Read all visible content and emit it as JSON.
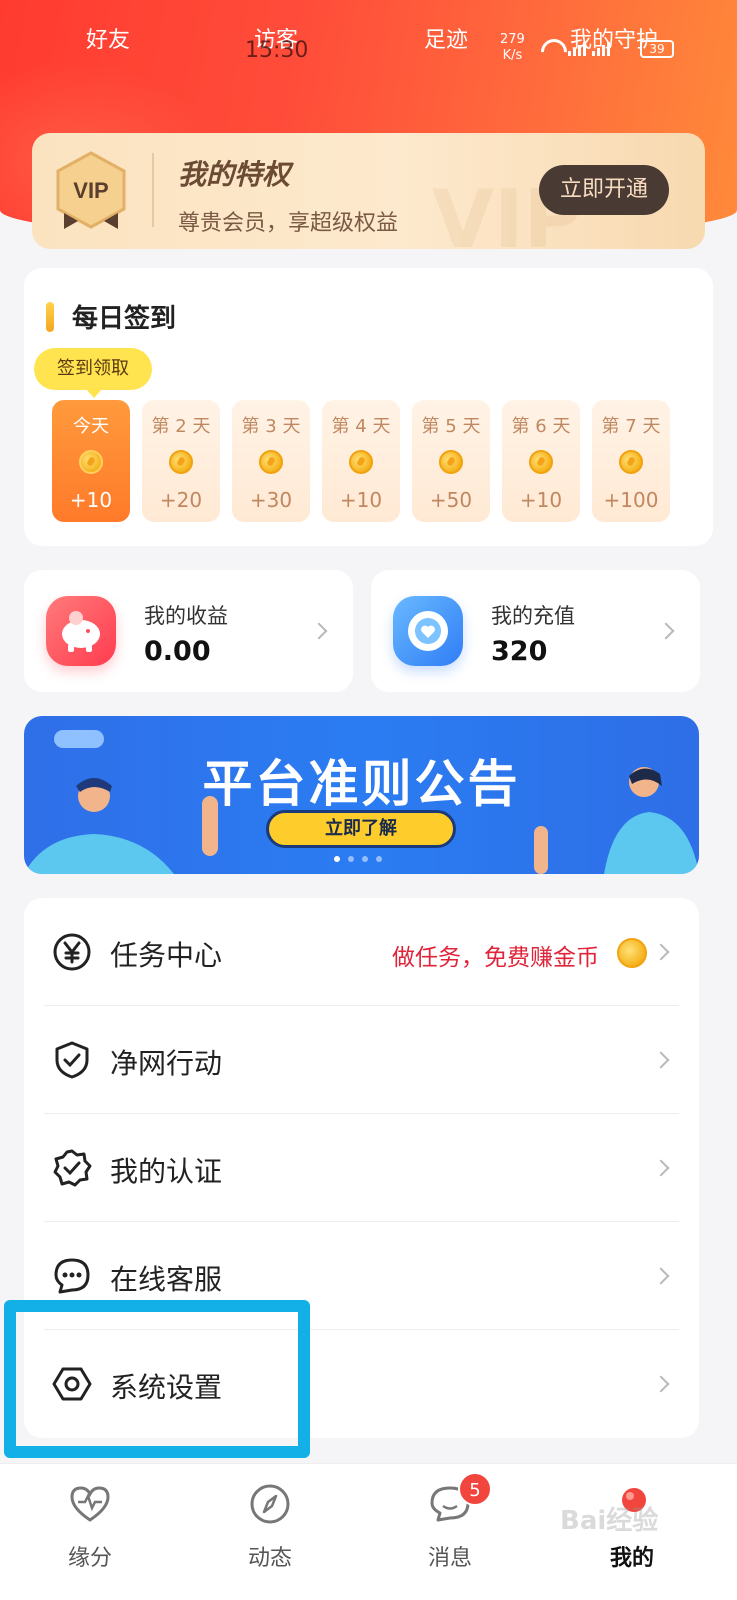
{
  "status_bar": {
    "time": "15:30",
    "speed": "279\nK/s",
    "battery": "39"
  },
  "top_nav": [
    "好友",
    "访客",
    "足迹",
    "我的守护"
  ],
  "vip": {
    "badge": "VIP",
    "title": "我的特权",
    "subtitle": "尊贵会员，享超级权益",
    "button": "立即开通",
    "watermark": "VIP"
  },
  "checkin": {
    "title": "每日签到",
    "tip": "签到领取",
    "days": [
      {
        "label": "今天",
        "points": "+10",
        "today": true
      },
      {
        "label": "第 2 天",
        "points": "+20"
      },
      {
        "label": "第 3 天",
        "points": "+30"
      },
      {
        "label": "第 4 天",
        "points": "+10"
      },
      {
        "label": "第 5 天",
        "points": "+50"
      },
      {
        "label": "第 6 天",
        "points": "+10"
      },
      {
        "label": "第 7 天",
        "points": "+100"
      }
    ]
  },
  "income": {
    "label": "我的收益",
    "value": "0.00"
  },
  "recharge": {
    "label": "我的充值",
    "value": "320"
  },
  "banner": {
    "title": "平台准则公告",
    "button": "立即了解"
  },
  "menu": [
    {
      "label": "任务中心",
      "extra": "做任务，免费赚金币",
      "icon": "yen-icon"
    },
    {
      "label": "净网行动",
      "icon": "shield-check-icon"
    },
    {
      "label": "我的认证",
      "icon": "badge-check-icon"
    },
    {
      "label": "在线客服",
      "icon": "chat-bubble-icon"
    },
    {
      "label": "系统设置",
      "icon": "settings-hexagon-icon"
    }
  ],
  "bottom_nav": [
    {
      "label": "缘分",
      "icon": "heart-pulse-icon"
    },
    {
      "label": "动态",
      "icon": "compass-icon"
    },
    {
      "label": "消息",
      "icon": "message-icon",
      "badge": "5"
    },
    {
      "label": "我的",
      "icon": "profile-icon",
      "active": true
    }
  ],
  "watermark": "Bai经验",
  "colors": {
    "accent": "#ff3b2f",
    "highlight": "#12b0e6",
    "extra_text": "#e0253a"
  }
}
